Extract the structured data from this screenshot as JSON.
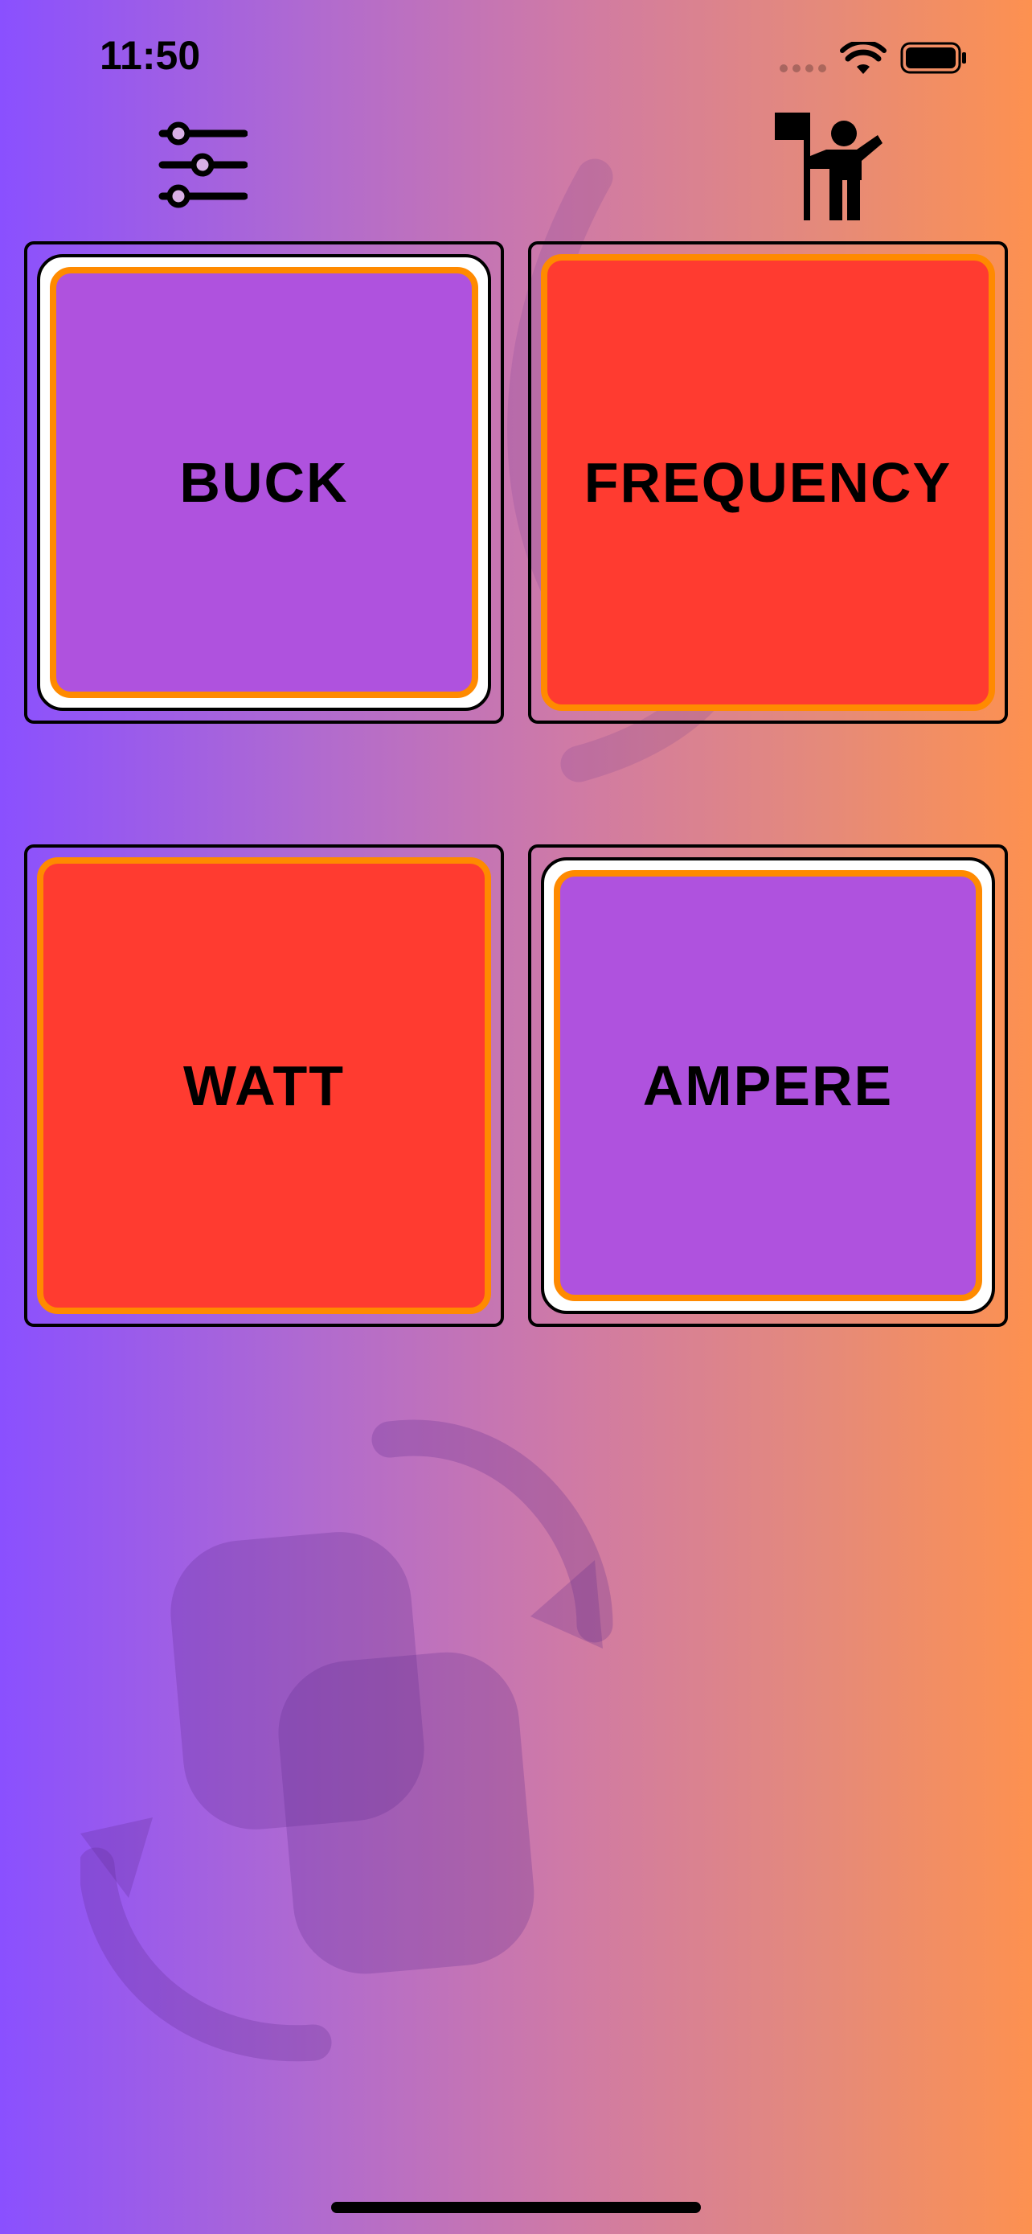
{
  "status_bar": {
    "time": "11:50"
  },
  "toolbar": {
    "settings_icon": "sliders-icon",
    "help_icon": "person-with-flag-icon"
  },
  "cards": [
    {
      "label": "BUCK",
      "color": "#af52de",
      "selected": true
    },
    {
      "label": "FREQUENCY",
      "color": "#ff3b30",
      "selected": false
    },
    {
      "label": "WATT",
      "color": "#ff3b30",
      "selected": false
    },
    {
      "label": "AMPERE",
      "color": "#af52de",
      "selected": true
    }
  ],
  "colors": {
    "gradient_start": "#8a50ff",
    "gradient_end": "#fd9150",
    "card_border_accent": "#ff8a00"
  }
}
